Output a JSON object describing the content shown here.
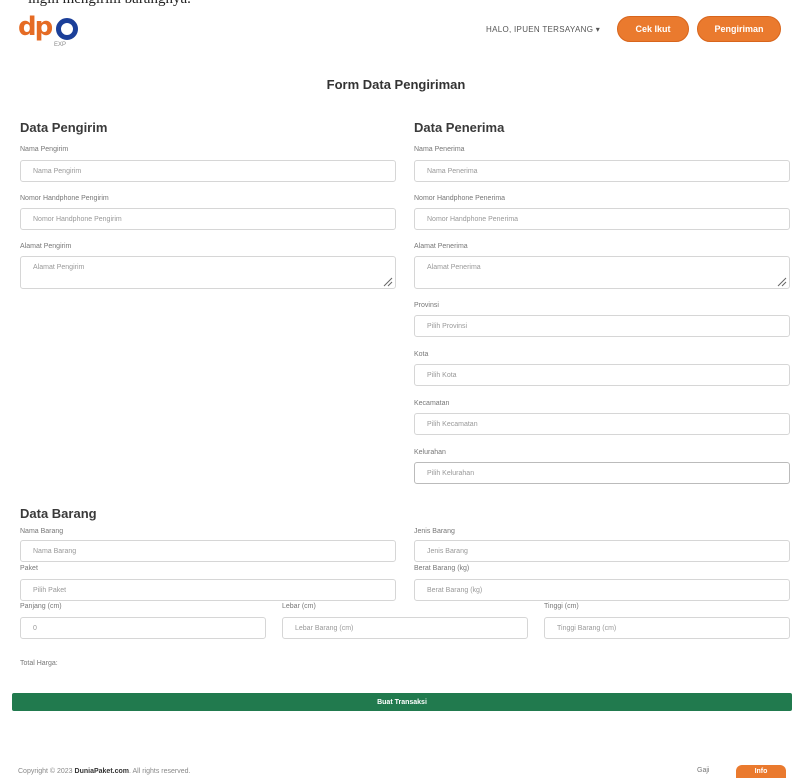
{
  "caption": "ingin mengirim barangnya.",
  "navbar": {
    "logo_text": "dp",
    "logo_sub": "EXP",
    "user_menu": "HALO, IPUEN TERSAYANG ▾",
    "btn_cek": "Cek Ikut",
    "btn_pengiriman": "Pengiriman"
  },
  "page_title": "Form Data Pengiriman",
  "pengirim": {
    "title": "Data Pengirim",
    "nama_label": "Nama Pengirim",
    "nama_placeholder": "Nama Pengirim",
    "hp_label": "Nomor Handphone Pengirim",
    "hp_placeholder": "Nomor Handphone Pengirim",
    "alamat_label": "Alamat Pengirim",
    "alamat_placeholder": "Alamat Pengirim"
  },
  "penerima": {
    "title": "Data Penerima",
    "nama_label": "Nama Penerima",
    "nama_placeholder": "Nama Penerima",
    "hp_label": "Nomor Handphone Penerima",
    "hp_placeholder": "Nomor Handphone Penerima",
    "alamat_label": "Alamat Penerima",
    "alamat_placeholder": "Alamat Penerima",
    "provinsi_label": "Provinsi",
    "provinsi_value": "Pilih Provinsi",
    "kota_label": "Kota",
    "kota_value": "Pilih Kota",
    "kecamatan_label": "Kecamatan",
    "kecamatan_value": "Pilih Kecamatan",
    "kelurahan_label": "Kelurahan",
    "kelurahan_value": "Pilih Kelurahan"
  },
  "barang": {
    "title": "Data Barang",
    "nama_label": "Nama Barang",
    "nama_placeholder": "Nama Barang",
    "jenis_label": "Jenis Barang",
    "jenis_placeholder": "Jenis Barang",
    "paket_label": "Paket",
    "paket_value": "Pilih Paket",
    "berat_label": "Berat Barang (kg)",
    "berat_placeholder": "Berat Barang (kg)",
    "panjang_label": "Panjang (cm)",
    "panjang_value": "0",
    "lebar_label": "Lebar (cm)",
    "lebar_placeholder": "Lebar Barang (cm)",
    "tinggi_label": "Tinggi (cm)",
    "tinggi_placeholder": "Tinggi Barang (cm)",
    "total_label": "Total Harga:"
  },
  "submit_label": "Buat Transaksi",
  "footer": {
    "copyright_prefix": "Copyright © 2023 ",
    "brand": "DuniaPaket.com",
    "copyright_suffix": ". All rights reserved.",
    "link": "Gaji",
    "button": "Info"
  },
  "colors": {
    "accent": "#ea7a2e",
    "brand_blue": "#1b3f99",
    "submit": "#217a4e"
  }
}
